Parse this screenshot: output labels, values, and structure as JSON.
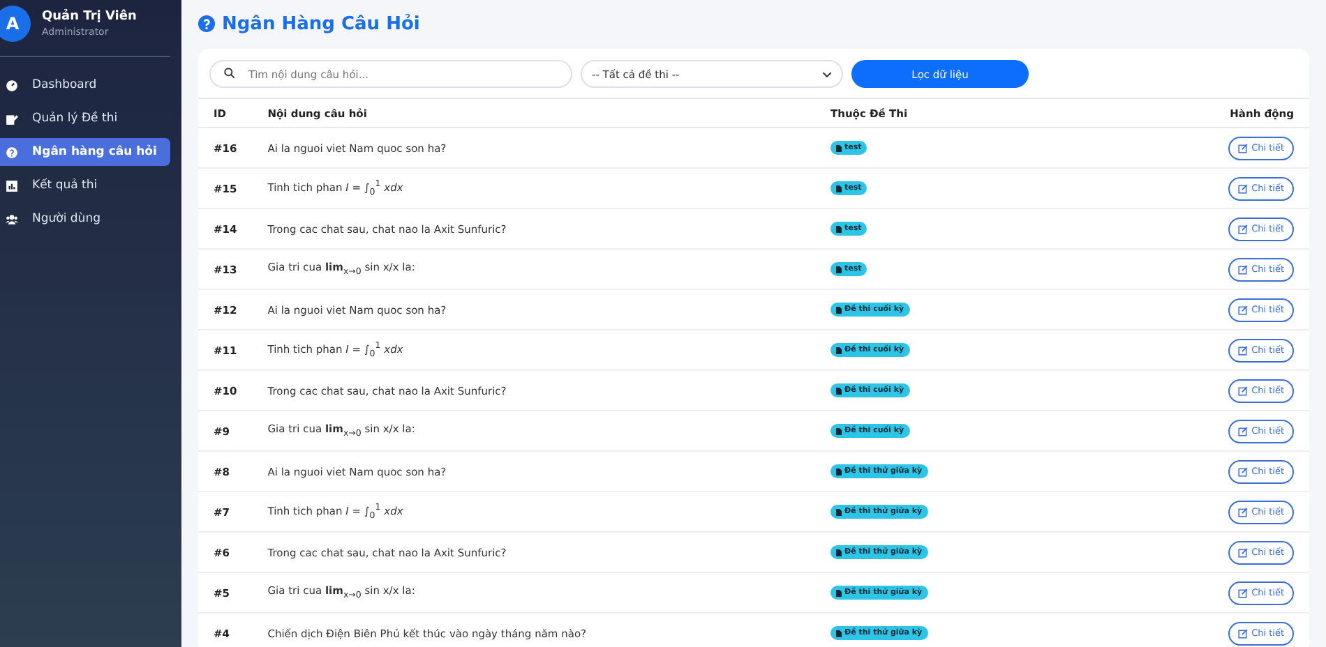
{
  "sidebar": {
    "user": {
      "avatar": "A",
      "name": "Quản Trị Viên",
      "role": "Administrator"
    },
    "items": [
      {
        "label": "Dashboard",
        "selected": false
      },
      {
        "label": "Quản lý Đề thi",
        "selected": false
      },
      {
        "label": "Ngân hàng câu hỏi",
        "selected": true
      },
      {
        "label": "Kết quả thi",
        "selected": false
      },
      {
        "label": "Người dùng",
        "selected": false
      }
    ]
  },
  "page_title": "Ngân Hàng Câu Hỏi",
  "filters": {
    "search_placeholder": "Tìm nội dung câu hỏi...",
    "exam_select": "-- Tất cả đề thi --",
    "filter_button": "Lọc dữ liệu"
  },
  "table": {
    "columns": [
      "ID",
      "Nội dung câu hỏi",
      "Thuộc Đề Thi",
      "Hành động"
    ],
    "rows": [
      {
        "id": "#16",
        "question": "Ai la nguoi viet Nam quoc son ha?",
        "exam": "test",
        "action": "Chi tiết"
      },
      {
        "id": "#15",
        "question": "Tinh tich phan *I* = ∫$_{0}$$^{1}$ *xdx*",
        "exam": "test",
        "action": "Chi tiết"
      },
      {
        "id": "#14",
        "question": "Trong cac chat sau, chat nao la Axit Sunfuric?",
        "exam": "test",
        "action": "Chi tiết"
      },
      {
        "id": "#13",
        "question": "Gia tri cua **lim**$_{x→0}$ sin x/x la:",
        "exam": "test",
        "action": "Chi tiết"
      },
      {
        "id": "#12",
        "question": "Ai la nguoi viet Nam quoc son ha?",
        "exam": "Đề thi cuối kỳ",
        "action": "Chi tiết"
      },
      {
        "id": "#11",
        "question": "Tinh tich phan *I* = ∫$_{0}$$^{1}$ *xdx*",
        "exam": "Đề thi cuối kỳ",
        "action": "Chi tiết"
      },
      {
        "id": "#10",
        "question": "Trong cac chat sau, chat nao la Axit Sunfuric?",
        "exam": "Đề thi cuối kỳ",
        "action": "Chi tiết"
      },
      {
        "id": "#9",
        "question": "Gia tri cua **lim**$_{x→0}$ sin x/x la:",
        "exam": "Đề thi cuối kỳ",
        "action": "Chi tiết"
      },
      {
        "id": "#8",
        "question": "Ai la nguoi viet Nam quoc son ha?",
        "exam": "Đề thi thử giữa kỳ",
        "action": "Chi tiết"
      },
      {
        "id": "#7",
        "question": "Tinh tich phan *I* = ∫$_{0}$$^{1}$ *xdx*",
        "exam": "Đề thi thử giữa kỳ",
        "action": "Chi tiết"
      },
      {
        "id": "#6",
        "question": "Trong cac chat sau, chat nao la Axit Sunfuric?",
        "exam": "Đề thi thử giữa kỳ",
        "action": "Chi tiết"
      },
      {
        "id": "#5",
        "question": "Gia tri cua **lim**$_{x→0}$ sin x/x la:",
        "exam": "Đề thi thử giữa kỳ",
        "action": "Chi tiết"
      },
      {
        "id": "#4",
        "question": "Chiến dịch Điện Biên Phủ kết thúc vào ngày tháng năm nào?",
        "exam": "Đề thi thử giữa kỳ",
        "action": "Chi tiết"
      }
    ]
  }
}
